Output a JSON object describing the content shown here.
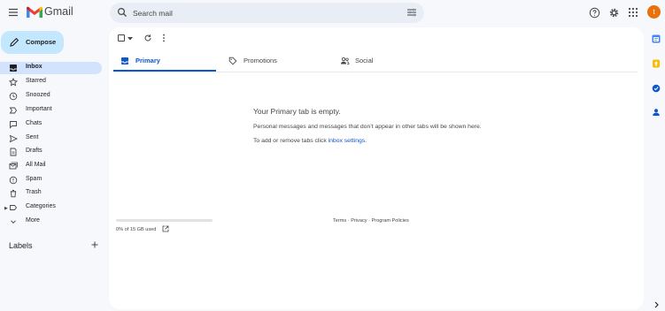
{
  "header": {
    "app_name": "Gmail",
    "search_placeholder": "Search mail",
    "avatar_initial": "t"
  },
  "compose": {
    "label": "Compose"
  },
  "sidebar": {
    "items": [
      {
        "id": "inbox",
        "label": "Inbox",
        "icon": "inbox-icon",
        "active": true
      },
      {
        "id": "starred",
        "label": "Starred",
        "icon": "star-icon"
      },
      {
        "id": "snoozed",
        "label": "Snoozed",
        "icon": "clock-icon"
      },
      {
        "id": "important",
        "label": "Important",
        "icon": "important-icon"
      },
      {
        "id": "chats",
        "label": "Chats",
        "icon": "chat-icon"
      },
      {
        "id": "sent",
        "label": "Sent",
        "icon": "send-icon"
      },
      {
        "id": "drafts",
        "label": "Drafts",
        "icon": "draft-icon"
      },
      {
        "id": "all-mail",
        "label": "All Mail",
        "icon": "all-mail-icon"
      },
      {
        "id": "spam",
        "label": "Spam",
        "icon": "spam-icon"
      },
      {
        "id": "trash",
        "label": "Trash",
        "icon": "trash-icon"
      },
      {
        "id": "categories",
        "label": "Categories",
        "icon": "label-icon"
      },
      {
        "id": "more",
        "label": "More",
        "icon": "chevron-down-icon"
      }
    ],
    "labels_title": "Labels"
  },
  "tabs": [
    {
      "id": "primary",
      "label": "Primary",
      "icon": "inbox-icon",
      "active": true
    },
    {
      "id": "promotions",
      "label": "Promotions",
      "icon": "tag-icon"
    },
    {
      "id": "social",
      "label": "Social",
      "icon": "people-icon"
    }
  ],
  "empty_state": {
    "title": "Your Primary tab is empty.",
    "description": "Personal messages and messages that don’t appear in other tabs will be shown here.",
    "hint_prefix": "To add or remove tabs click ",
    "hint_link": "inbox settings",
    "hint_suffix": "."
  },
  "storage": {
    "text": "0% of 15 GB used",
    "used_fraction": 0
  },
  "footer": {
    "terms": "Terms",
    "privacy": "Privacy",
    "policies": "Program Policies",
    "separator": " · "
  },
  "colors": {
    "accent": "#0b57d0",
    "compose_bg": "#c2e7ff",
    "active_nav_bg": "#d3e3fd",
    "avatar_bg": "#e8710a"
  }
}
